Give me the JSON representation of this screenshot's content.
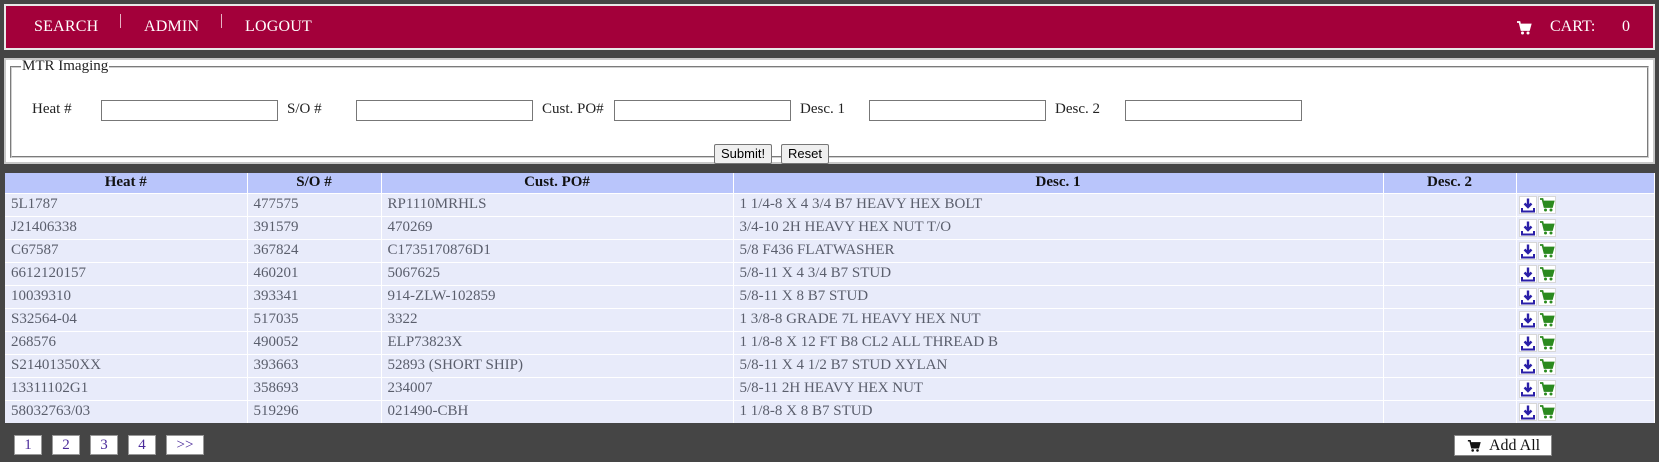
{
  "nav": {
    "search_label": "SEARCH",
    "admin_label": "ADMIN",
    "logout_label": "LOGOUT",
    "cart_label": "CART:",
    "cart_count": "0"
  },
  "form": {
    "legend": "MTR Imaging",
    "heat_label": "Heat #",
    "so_label": "S/O #",
    "custpo_label": "Cust. PO#",
    "desc1_label": "Desc. 1",
    "desc2_label": "Desc. 2",
    "heat_value": "",
    "so_value": "",
    "custpo_value": "",
    "desc1_value": "",
    "desc2_value": "",
    "submit_label": "Submit!",
    "reset_label": "Reset"
  },
  "table": {
    "columns": [
      "Heat #",
      "S/O #",
      "Cust. PO#",
      "Desc. 1",
      "Desc. 2",
      ""
    ],
    "rows": [
      {
        "heat": "5L1787",
        "so": "477575",
        "custpo": "RP1110MRHLS",
        "desc1": "1 1/4-8 X 4 3/4 B7 HEAVY HEX BOLT",
        "desc2": ""
      },
      {
        "heat": "J21406338",
        "so": "391579",
        "custpo": "470269",
        "desc1": "3/4-10 2H HEAVY HEX NUT T/O",
        "desc2": ""
      },
      {
        "heat": "C67587",
        "so": "367824",
        "custpo": "C1735170876D1",
        "desc1": "5/8 F436 FLATWASHER",
        "desc2": ""
      },
      {
        "heat": "6612120157",
        "so": "460201",
        "custpo": "5067625",
        "desc1": "5/8-11 X 4 3/4 B7 STUD",
        "desc2": ""
      },
      {
        "heat": "10039310",
        "so": "393341",
        "custpo": "914-ZLW-102859",
        "desc1": "5/8-11 X 8 B7 STUD",
        "desc2": ""
      },
      {
        "heat": "S32564-04",
        "so": "517035",
        "custpo": "3322",
        "desc1": "1 3/8-8 GRADE 7L HEAVY HEX NUT",
        "desc2": ""
      },
      {
        "heat": "268576",
        "so": "490052",
        "custpo": "ELP73823X",
        "desc1": "1 1/8-8 X 12 FT B8 CL2 ALL THREAD B",
        "desc2": ""
      },
      {
        "heat": "S21401350XX",
        "so": "393663",
        "custpo": "52893 (SHORT SHIP)",
        "desc1": "5/8-11 X 4 1/2 B7 STUD XYLAN",
        "desc2": ""
      },
      {
        "heat": "13311102G1",
        "so": "358693",
        "custpo": "234007",
        "desc1": "5/8-11 2H HEAVY HEX NUT",
        "desc2": ""
      },
      {
        "heat": "58032763/03",
        "so": "519296",
        "custpo": "021490-CBH",
        "desc1": "1 1/8-8 X 8 B7 STUD",
        "desc2": ""
      }
    ],
    "row_icons": [
      "download-icon",
      "cart-icon"
    ]
  },
  "pager": {
    "pages": [
      "1",
      "2",
      "3",
      "4"
    ],
    "next_label": ">>",
    "current": "1"
  },
  "add_all_label": "Add All",
  "colors": {
    "nav_bg": "#a3003a",
    "page_bg": "#454545",
    "header_bg": "#b9c5fb",
    "row_bg": "#e8ebfa",
    "download_icon": "#2a1fa8",
    "cart_icon": "#2b8a1f"
  }
}
